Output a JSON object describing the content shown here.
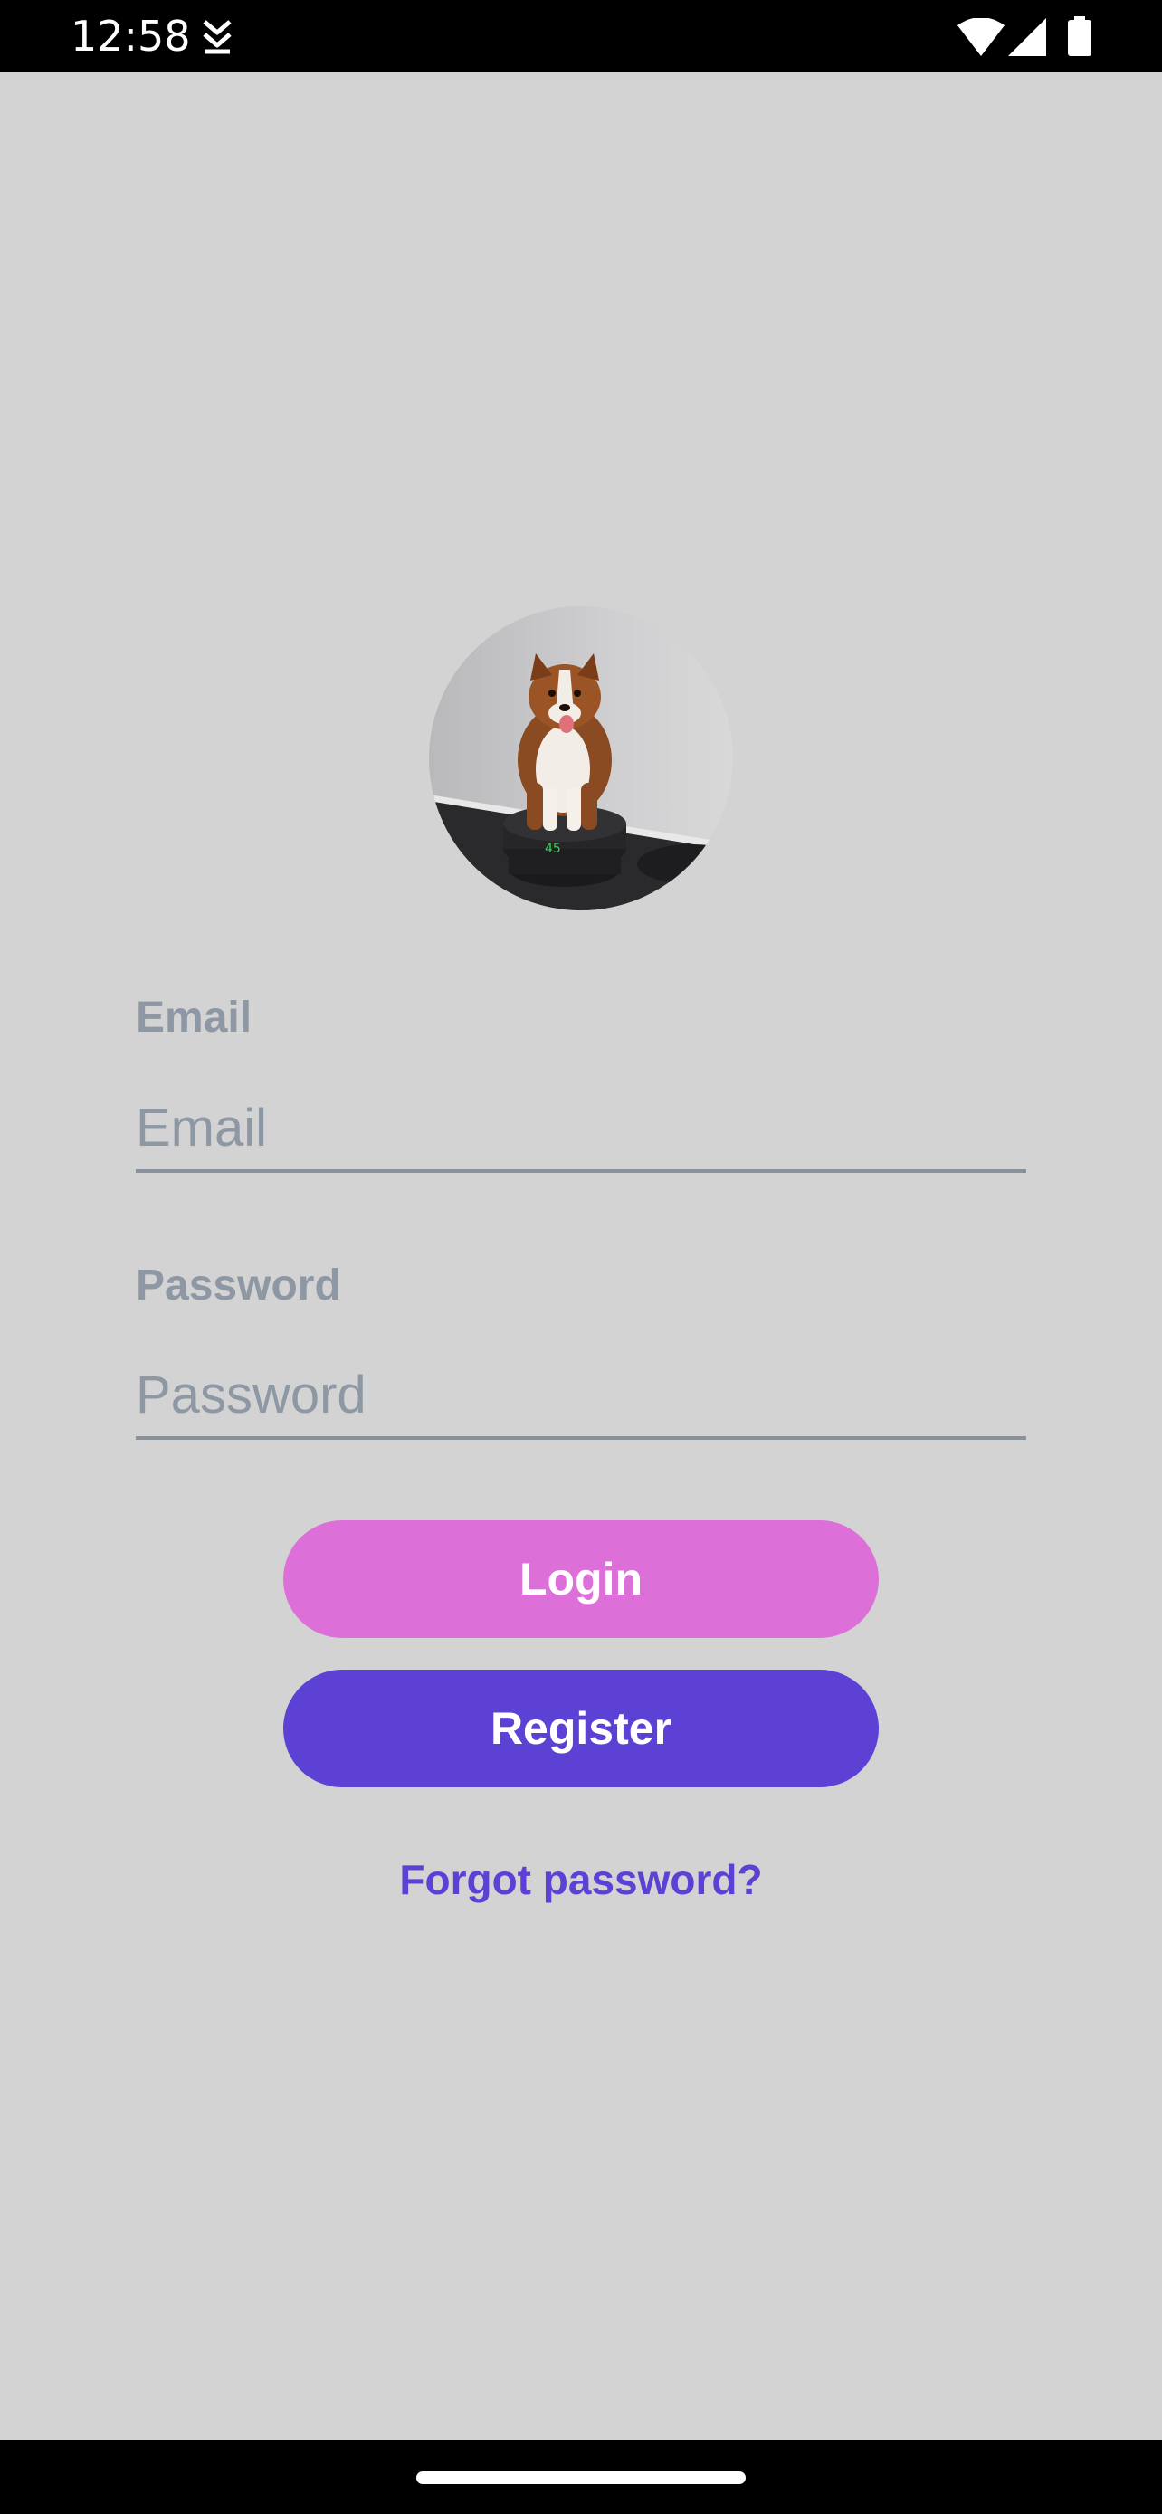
{
  "status_bar": {
    "time": "12:58",
    "download_icon": "download-arrow-icon",
    "wifi_icon": "wifi-icon",
    "signal_icon": "cellular-signal-icon",
    "battery_icon": "battery-icon"
  },
  "avatar": {
    "icon": "dog-photo"
  },
  "form": {
    "email_label": "Email",
    "email_placeholder": "Email",
    "email_value": "",
    "password_label": "Password",
    "password_placeholder": "Password",
    "password_value": ""
  },
  "buttons": {
    "login_label": "Login",
    "register_label": "Register",
    "forgot_label": "Forgot password?"
  },
  "colors": {
    "background": "#d3d3d4",
    "login": "#dc6fd8",
    "register": "#5c41d4",
    "link": "#5c41d4",
    "label": "#8e98a4"
  }
}
